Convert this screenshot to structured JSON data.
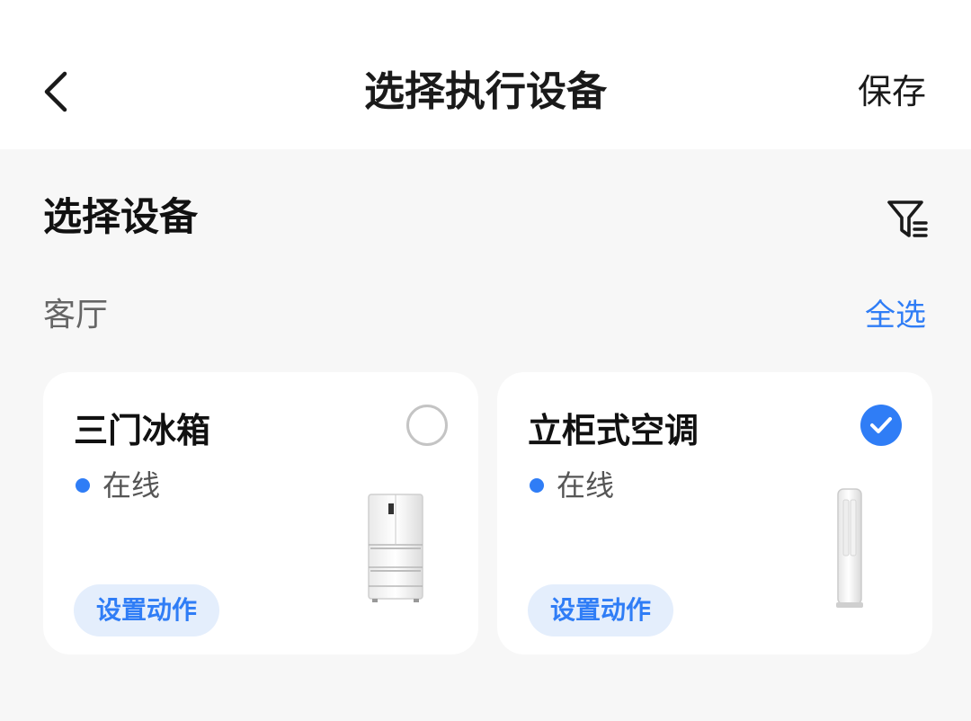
{
  "header": {
    "title": "选择执行设备",
    "save_label": "保存",
    "back_icon": "chevron-left-icon"
  },
  "section": {
    "title": "选择设备",
    "filter_icon": "filter-icon"
  },
  "room": {
    "name": "客厅",
    "select_all_label": "全选"
  },
  "devices": [
    {
      "name": "三门冰箱",
      "status": "在线",
      "selected": false,
      "action_label": "设置动作",
      "image": "refrigerator-image"
    },
    {
      "name": "立柜式空调",
      "status": "在线",
      "selected": true,
      "action_label": "设置动作",
      "image": "air-conditioner-image"
    }
  ],
  "colors": {
    "accent": "#2f7df6",
    "background": "#f7f7f7",
    "card": "#ffffff",
    "action_bg": "#e4eefc"
  }
}
